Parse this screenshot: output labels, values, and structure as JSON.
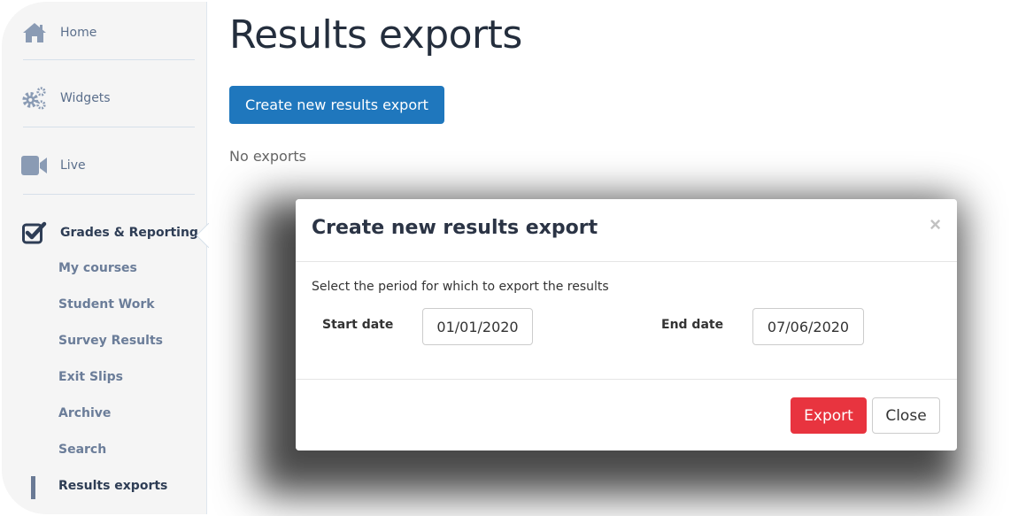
{
  "sidebar": {
    "main_items": [
      {
        "label": "Home",
        "icon": "home-icon"
      },
      {
        "label": "Widgets",
        "icon": "gears-icon"
      },
      {
        "label": "Live",
        "icon": "video-camera-icon"
      },
      {
        "label": "Grades & Reporting",
        "icon": "checkbox-checked-icon",
        "active": true
      }
    ],
    "sub_items": [
      {
        "label": "My courses"
      },
      {
        "label": "Student Work"
      },
      {
        "label": "Survey Results"
      },
      {
        "label": "Exit Slips"
      },
      {
        "label": "Archive"
      },
      {
        "label": "Search"
      },
      {
        "label": "Results exports",
        "active": true
      }
    ]
  },
  "main": {
    "title": "Results exports",
    "create_button_label": "Create new results export",
    "empty_text": "No exports"
  },
  "modal": {
    "title": "Create new results export",
    "close_symbol": "×",
    "description": "Select the period for which to export the results",
    "start_date_label": "Start date",
    "start_date_value": "01/01/2020",
    "end_date_label": "End date",
    "end_date_value": "07/06/2020",
    "export_label": "Export",
    "close_label": "Close"
  },
  "colors": {
    "primary": "#1f77bd",
    "danger": "#e8343f",
    "sidebar_icon": "#8a9bb4",
    "active_text": "#2e3d55"
  }
}
